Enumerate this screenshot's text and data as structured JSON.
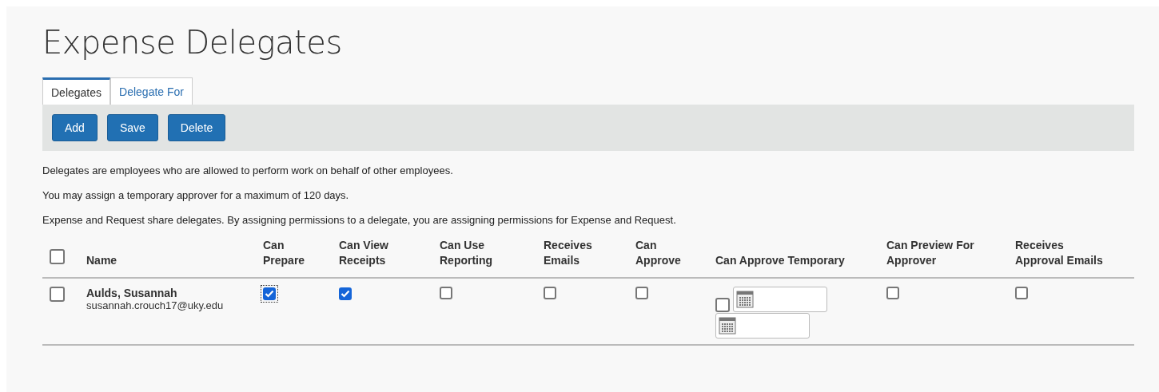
{
  "title": "Expense Delegates",
  "tabs": [
    {
      "label": "Delegates",
      "selected": true
    },
    {
      "label": "Delegate For",
      "selected": false
    }
  ],
  "toolbar": {
    "buttons": [
      "Add",
      "Save",
      "Delete"
    ]
  },
  "notes": [
    "Delegates are employees who are allowed to perform work on behalf of other employees.",
    "You may assign a temporary approver for a maximum of 120 days.",
    "Expense and Request share delegates. By assigning permissions to a delegate, you are assigning permissions for Expense and Request."
  ],
  "table": {
    "select_all": {
      "checked": false
    },
    "columns": [
      "Name",
      "Can\nPrepare",
      "Can View\nReceipts",
      "Can Use\nReporting",
      "Receives\nEmails",
      "Can\nApprove",
      "Can Approve Temporary",
      "Can Preview For\nApprover",
      "Receives\nApproval Emails"
    ],
    "rows": [
      {
        "checked": false,
        "name": "Aulds, Susannah",
        "email": "susannah.crouch17@uky.edu",
        "permissions": [
          {
            "kind": "checkbox",
            "checked": true,
            "focused": true
          },
          {
            "kind": "checkbox",
            "checked": true,
            "focused": false
          },
          {
            "kind": "checkbox",
            "checked": false,
            "focused": false
          },
          {
            "kind": "checkbox",
            "checked": false,
            "focused": false
          },
          {
            "kind": "checkbox",
            "checked": false,
            "focused": false
          },
          {
            "kind": "temporary",
            "checked": false,
            "focused": false
          },
          {
            "kind": "checkbox",
            "checked": false,
            "focused": false
          },
          {
            "kind": "checkbox",
            "checked": false,
            "focused": false
          }
        ]
      }
    ]
  }
}
